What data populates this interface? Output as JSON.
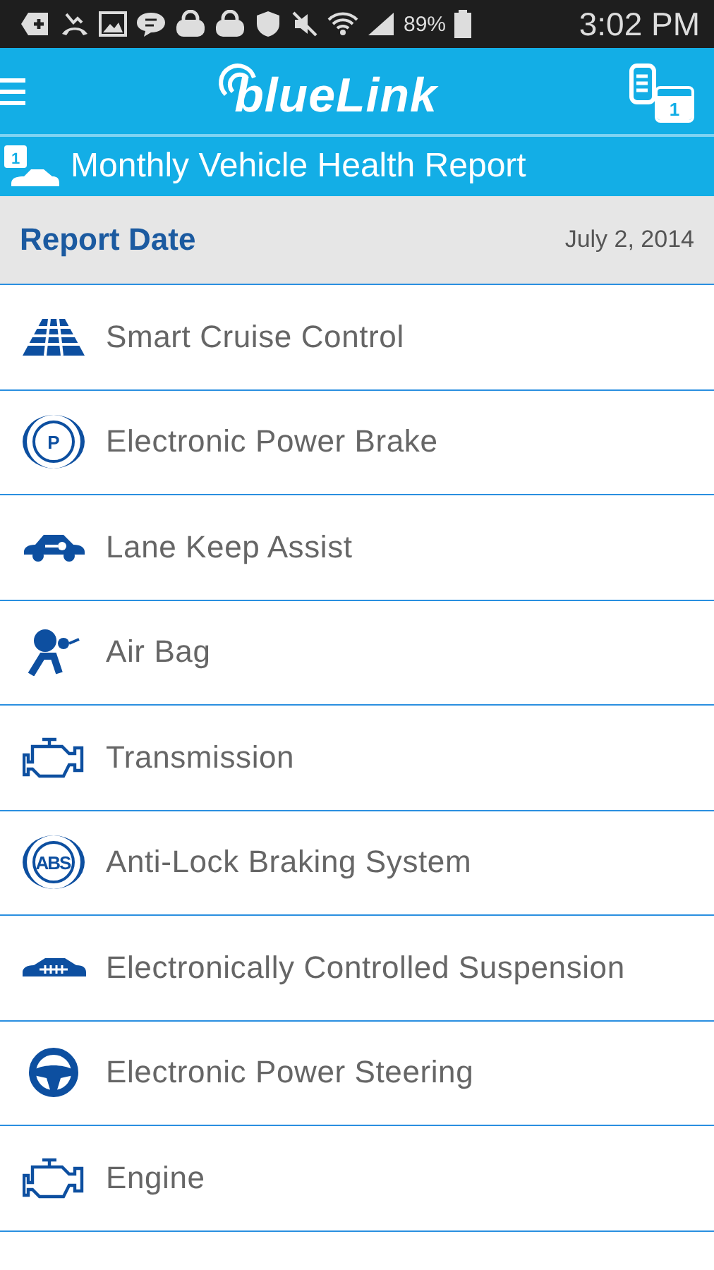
{
  "status_bar": {
    "battery": "89%",
    "time": "3:02 PM"
  },
  "header": {
    "logo": "blueLink",
    "calendar_day": "1"
  },
  "title_bar": {
    "title": "Monthly Vehicle Health Report",
    "calendar_day": "1"
  },
  "report_date": {
    "label": "Report Date",
    "value": "July 2, 2014"
  },
  "items": [
    {
      "label": "Smart Cruise Control",
      "kind": "road"
    },
    {
      "label": "Electronic Power Brake",
      "kind": "badge",
      "icon_text": "P"
    },
    {
      "label": "Lane Keep Assist",
      "kind": "car-key"
    },
    {
      "label": "Air Bag",
      "kind": "airbag"
    },
    {
      "label": "Transmission",
      "kind": "engine"
    },
    {
      "label": "Anti-Lock Braking System",
      "kind": "badge",
      "icon_text": "ABS"
    },
    {
      "label": "Electronically Controlled Suspension",
      "kind": "car-spring"
    },
    {
      "label": "Electronic Power Steering",
      "kind": "wheel"
    },
    {
      "label": "Engine",
      "kind": "engine"
    }
  ]
}
